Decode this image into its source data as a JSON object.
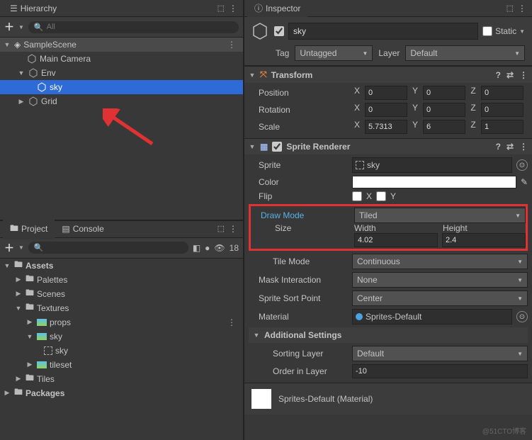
{
  "hierarchy": {
    "title": "Hierarchy",
    "search_placeholder": "All",
    "scene": "SampleScene",
    "items": [
      "Main Camera",
      "Env",
      "sky",
      "Grid"
    ]
  },
  "project": {
    "tab_project": "Project",
    "tab_console": "Console",
    "hidden_count": "18",
    "root": "Assets",
    "folders": [
      "Palettes",
      "Scenes",
      "Textures"
    ],
    "textures_children": [
      "props",
      "sky",
      "sky",
      "tileset"
    ],
    "tiles": "Tiles",
    "packages": "Packages"
  },
  "inspector": {
    "title": "Inspector",
    "name": "sky",
    "static": "Static",
    "tag_label": "Tag",
    "tag_value": "Untagged",
    "layer_label": "Layer",
    "layer_value": "Default",
    "transform": {
      "title": "Transform",
      "position_label": "Position",
      "rotation_label": "Rotation",
      "scale_label": "Scale",
      "pos": {
        "x": "0",
        "y": "0",
        "z": "0"
      },
      "rot": {
        "x": "0",
        "y": "0",
        "z": "0"
      },
      "scale": {
        "x": "5.7313",
        "y": "6",
        "z": "1"
      }
    },
    "sprite_renderer": {
      "title": "Sprite Renderer",
      "sprite_label": "Sprite",
      "sprite_value": "sky",
      "color_label": "Color",
      "flip_label": "Flip",
      "flip_x": "X",
      "flip_y": "Y",
      "draw_mode_label": "Draw Mode",
      "draw_mode_value": "Tiled",
      "size_label": "Size",
      "width_label": "Width",
      "height_label": "Height",
      "width_value": "4.02",
      "height_value": "2.4",
      "tile_mode_label": "Tile Mode",
      "tile_mode_value": "Continuous",
      "mask_label": "Mask Interaction",
      "mask_value": "None",
      "sort_point_label": "Sprite Sort Point",
      "sort_point_value": "Center",
      "material_label": "Material",
      "material_value": "Sprites-Default",
      "additional_label": "Additional Settings",
      "sorting_layer_label": "Sorting Layer",
      "sorting_layer_value": "Default",
      "order_label": "Order in Layer",
      "order_value": "-10"
    },
    "footer_material": "Sprites-Default (Material)"
  },
  "watermark": "@51CTO博客"
}
